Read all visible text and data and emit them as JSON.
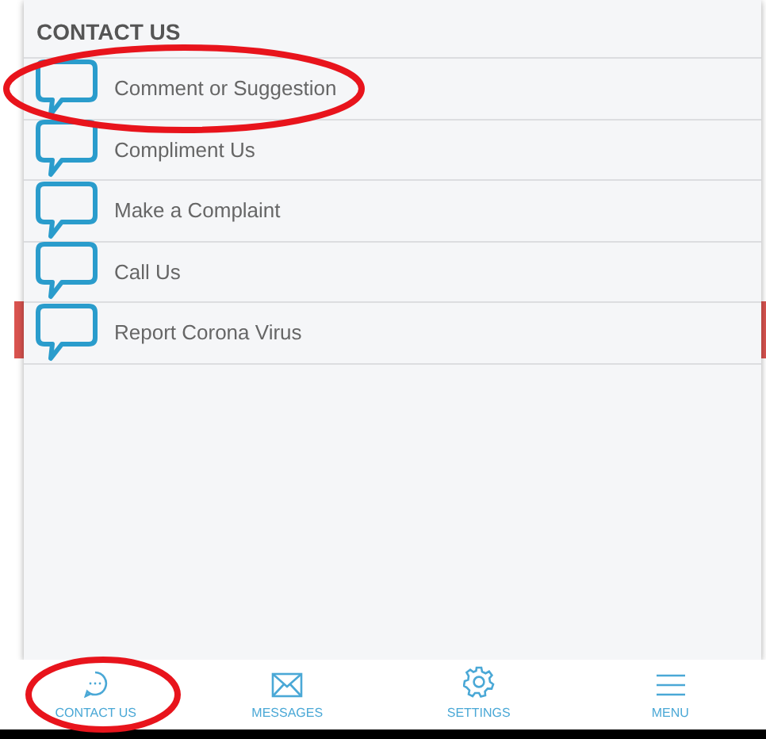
{
  "panel": {
    "title": "CONTACT US",
    "items": [
      {
        "label": "Comment or Suggestion",
        "circled": true
      },
      {
        "label": "Compliment Us",
        "circled": false
      },
      {
        "label": "Make a Complaint",
        "circled": false
      },
      {
        "label": "Call Us",
        "circled": false
      },
      {
        "label": "Report Corona Virus",
        "circled": false
      }
    ]
  },
  "bottom_nav": [
    {
      "label": "CONTACT US",
      "kind": "chat",
      "circled": true
    },
    {
      "label": "MESSAGES",
      "kind": "mail",
      "circled": false
    },
    {
      "label": "SETTINGS",
      "kind": "gear",
      "circled": false
    },
    {
      "label": "MENU",
      "kind": "menu",
      "circled": false
    }
  ]
}
